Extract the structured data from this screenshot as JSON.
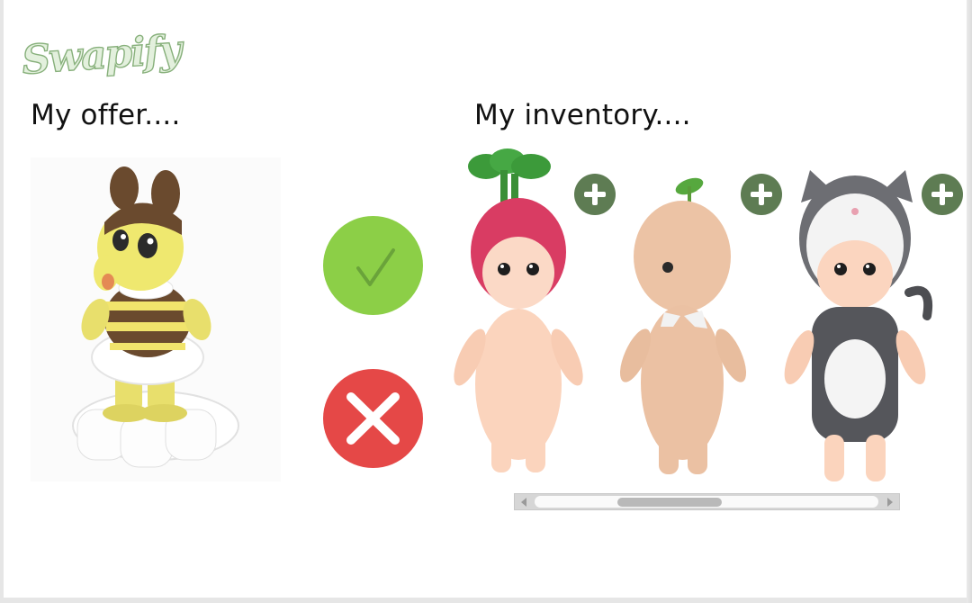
{
  "app": {
    "logo_text": "Swapify"
  },
  "offer": {
    "heading": "My offer....",
    "item_image": "bee-bunny-figure"
  },
  "inventory": {
    "heading": "My inventory....",
    "items": [
      {
        "image": "radish-hat-doll",
        "add_icon": "plus-icon"
      },
      {
        "image": "sprout-doll-back",
        "add_icon": "plus-icon"
      },
      {
        "image": "cat-hood-doll",
        "add_icon": "plus-icon"
      }
    ]
  },
  "actions": {
    "accept_icon": "check-icon",
    "reject_icon": "x-icon"
  },
  "colors": {
    "accept": "#8ccf47",
    "reject": "#e54847",
    "add": "#5e7c53",
    "logo_fill": "#e3f0dd",
    "logo_stroke": "#87b07b"
  }
}
